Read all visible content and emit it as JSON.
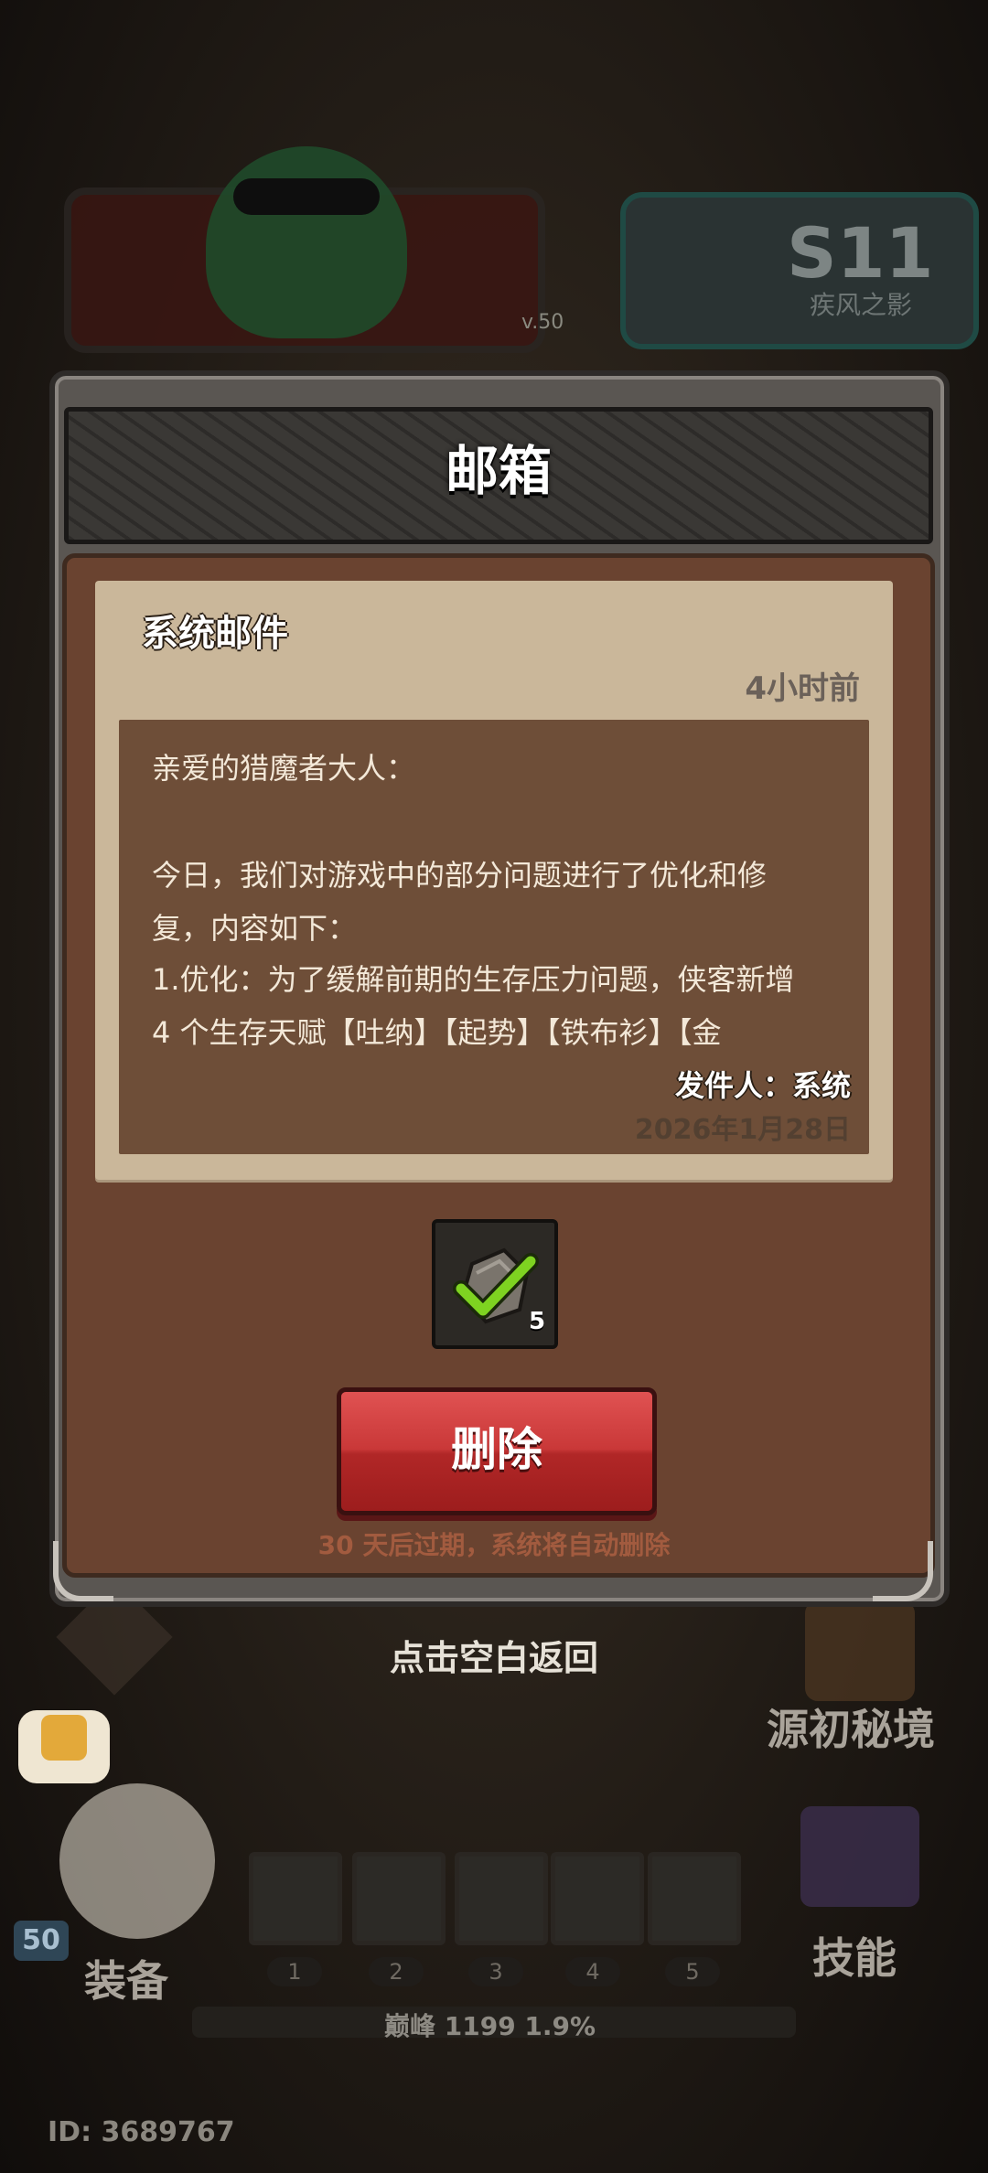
{
  "background": {
    "season_title": "S11",
    "season_subtitle": "疾风之影",
    "level_text": "v.50",
    "player_level": "50",
    "equip_label": "装备",
    "skill_label": "技能",
    "realm_label": "源初秘境",
    "slots": [
      "1",
      "2",
      "3",
      "4",
      "5"
    ],
    "xp_text": "巅峰 1199   1.9%",
    "player_id": "ID: 3689767"
  },
  "modal": {
    "title": "邮箱",
    "mail": {
      "title": "系统邮件",
      "time": "4小时前",
      "lines": [
        "亲爱的猎魔者大人：",
        "",
        "今日，我们对游戏中的部分问题进行了优化和修",
        "复，内容如下：",
        "1.优化：为了缓解前期的生存压力问题，侠客新增",
        "4 个生存天赋【吐纳】【起势】【铁布衫】【金"
      ],
      "sender": "发件人：系统",
      "date": "2026年1月28日"
    },
    "attachment": {
      "icon": "claimed-check-icon",
      "count": "5"
    },
    "delete_label": "删除",
    "expire_note": "30 天后过期，系统将自动删除"
  },
  "tap_back": "点击空白返回",
  "colors": {
    "delete_button": "#c93838",
    "check": "#7ed321",
    "paper": "#cab79a",
    "content_box": "#6e4e38"
  }
}
